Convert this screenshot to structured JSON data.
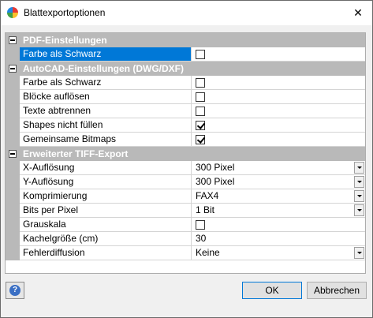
{
  "window": {
    "title": "Blattexportoptionen",
    "close_glyph": "✕"
  },
  "grid": {
    "pdf": {
      "title": "PDF-Einstellungen",
      "rows": [
        {
          "label": "Farbe als Schwarz",
          "checked": false
        }
      ]
    },
    "autocad": {
      "title": "AutoCAD-Einstellungen (DWG/DXF)",
      "rows": [
        {
          "label": "Farbe als Schwarz",
          "checked": false
        },
        {
          "label": "Blöcke auflösen",
          "checked": false
        },
        {
          "label": "Texte abtrennen",
          "checked": false
        },
        {
          "label": "Shapes nicht füllen",
          "checked": true
        },
        {
          "label": "Gemeinsame Bitmaps",
          "checked": true
        }
      ]
    },
    "tiff": {
      "title": "Erweiterter TIFF-Export",
      "rows": [
        {
          "label": "X-Auflösung",
          "value": "300 Pixel"
        },
        {
          "label": "Y-Auflösung",
          "value": "300 Pixel"
        },
        {
          "label": "Komprimierung",
          "value": "FAX4"
        },
        {
          "label": "Bits per Pixel",
          "value": "1 Bit"
        },
        {
          "label": "Grauskala",
          "checked": false
        },
        {
          "label": "Kachelgröße (cm)",
          "value": "30"
        },
        {
          "label": "Fehlerdiffusion",
          "value": "Keine"
        }
      ]
    }
  },
  "footer": {
    "help_glyph": "?",
    "ok_label": "OK",
    "cancel_label": "Abbrechen"
  }
}
